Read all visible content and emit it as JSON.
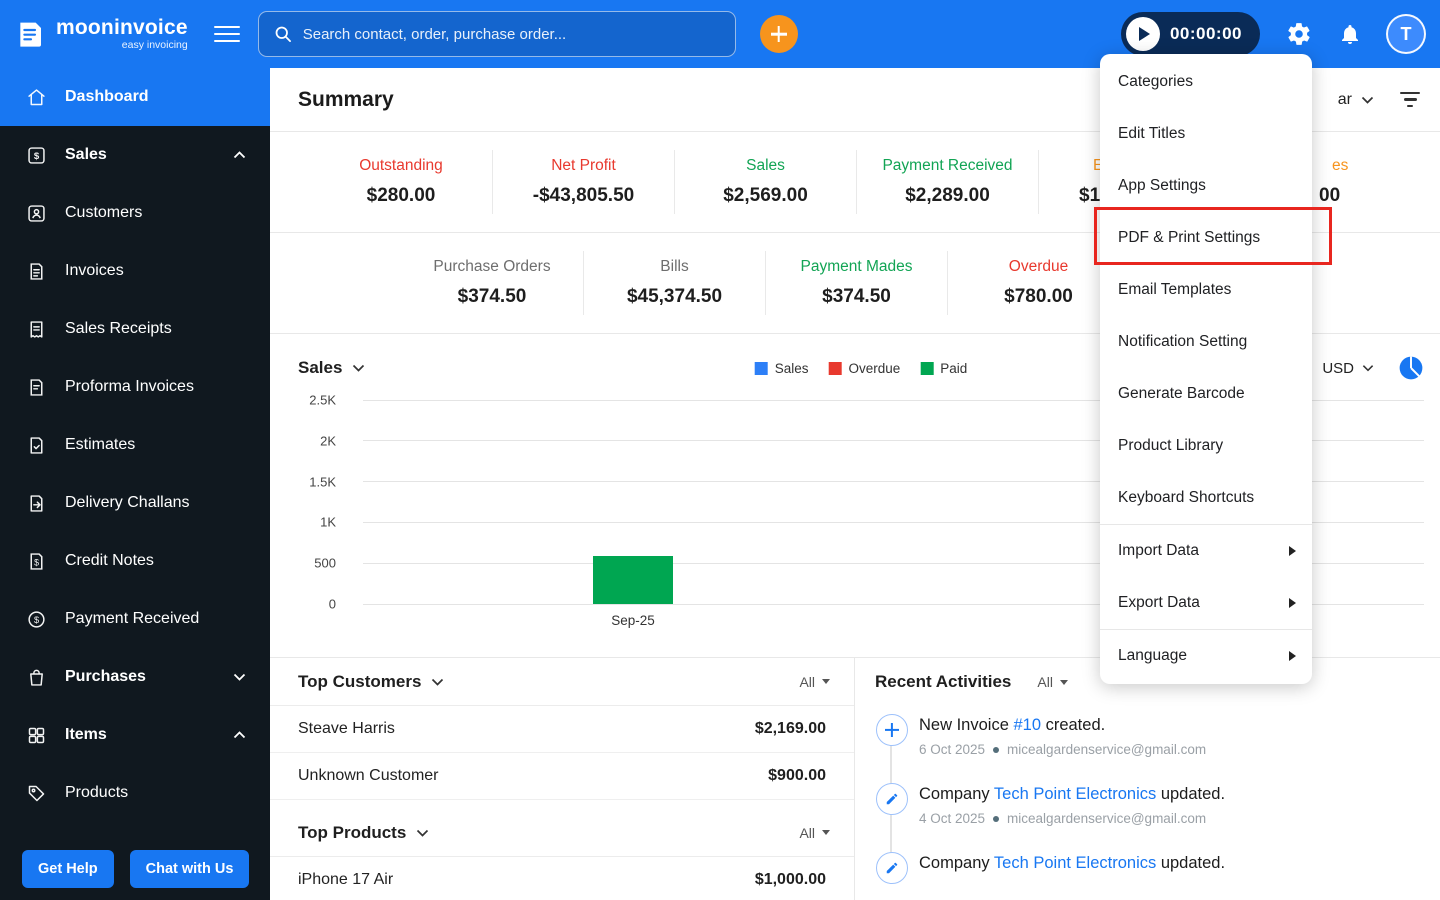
{
  "topbar": {
    "brand": "mooninvoice",
    "tagline": "easy invoicing",
    "search_placeholder": "Search contact, order, purchase order...",
    "timer": "00:00:00",
    "avatar_initial": "T"
  },
  "sidebar": {
    "items": [
      {
        "label": "Dashboard",
        "active": true
      },
      {
        "label": "Sales",
        "expanded": true
      },
      {
        "label": "Customers"
      },
      {
        "label": "Invoices"
      },
      {
        "label": "Sales Receipts"
      },
      {
        "label": "Proforma Invoices"
      },
      {
        "label": "Estimates"
      },
      {
        "label": "Delivery Challans"
      },
      {
        "label": "Credit Notes"
      },
      {
        "label": "Payment Received"
      },
      {
        "label": "Purchases",
        "expanded": false
      },
      {
        "label": "Items",
        "expanded": true
      },
      {
        "label": "Products"
      }
    ],
    "get_help_label": "Get Help",
    "chat_label": "Chat with Us"
  },
  "summary": {
    "title": "Summary",
    "period_fragment": "ar",
    "stats_row1": [
      {
        "label": "Outstanding",
        "value": "$280.00"
      },
      {
        "label": "Net Profit",
        "value": "-$43,805.50"
      },
      {
        "label": "Sales",
        "value": "$2,569.00"
      },
      {
        "label": "Payment Received",
        "value": "$2,289.00"
      },
      {
        "label": "E",
        "value": "$1"
      },
      {
        "label": "es",
        "value": "00"
      }
    ],
    "stats_row2": [
      {
        "label": "Purchase Orders",
        "value": "$374.50"
      },
      {
        "label": "Bills",
        "value": "$45,374.50"
      },
      {
        "label": "Payment Mades",
        "value": "$374.50"
      },
      {
        "label": "Overdue",
        "value": "$780.00"
      }
    ]
  },
  "chart_data": {
    "type": "bar",
    "title": "Sales",
    "currency": "USD",
    "categories": [
      "Sep-25"
    ],
    "series": [
      {
        "name": "Sales",
        "color": "#2D7FF7",
        "values": [
          0
        ]
      },
      {
        "name": "Overdue",
        "color": "#E8392E",
        "values": [
          0
        ]
      },
      {
        "name": "Paid",
        "color": "#00A651",
        "values": [
          585
        ]
      }
    ],
    "ylim": [
      0,
      2500
    ],
    "yticks": [
      {
        "label": "2.5K",
        "value": 2500
      },
      {
        "label": "2K",
        "value": 2000
      },
      {
        "label": "1.5K",
        "value": 1500
      },
      {
        "label": "1K",
        "value": 1000
      },
      {
        "label": "500",
        "value": 500
      },
      {
        "label": "0",
        "value": 0
      }
    ],
    "grid": true,
    "legend_position": "top-center"
  },
  "top_customers": {
    "title": "Top Customers",
    "filter": "All",
    "rows": [
      {
        "name": "Steave Harris",
        "amount": "$2,169.00"
      },
      {
        "name": "Unknown Customer",
        "amount": "$900.00"
      }
    ]
  },
  "top_products": {
    "title": "Top Products",
    "filter": "All",
    "rows": [
      {
        "name": "iPhone 17 Air",
        "amount": "$1,000.00"
      }
    ]
  },
  "recent_activities": {
    "title": "Recent Activities",
    "filter": "All",
    "entries": [
      {
        "text_prefix": "New Invoice ",
        "link": "#10",
        "text_suffix": " created.",
        "date": "6 Oct 2025",
        "email": "micealgardenservice@gmail.com"
      },
      {
        "text_prefix": "Company ",
        "link": "Tech Point Electronics",
        "text_suffix": " updated.",
        "date": "4 Oct 2025",
        "email": "micealgardenservice@gmail.com"
      },
      {
        "text_prefix": "Company ",
        "link": "Tech Point Electronics",
        "text_suffix": " updated.",
        "date": "",
        "email": ""
      }
    ]
  },
  "settings_menu": {
    "items": [
      {
        "label": "Categories"
      },
      {
        "label": "Edit Titles"
      },
      {
        "label": "App Settings"
      },
      {
        "label": "PDF & Print Settings",
        "highlighted": true
      },
      {
        "label": "Email Templates"
      },
      {
        "label": "Notification Setting"
      },
      {
        "label": "Generate Barcode"
      },
      {
        "label": "Product Library"
      },
      {
        "label": "Keyboard Shortcuts"
      },
      {
        "label": "Import Data",
        "submenu": true
      },
      {
        "label": "Export Data",
        "submenu": true
      },
      {
        "label": "Language",
        "submenu": true
      }
    ]
  },
  "colors": {
    "topbar_blue": "#1877F2",
    "sidebar_dark": "#10181F",
    "accent_orange": "#F7941D",
    "negative_red": "#E8392E",
    "positive_green": "#12A454",
    "link_blue": "#1877F2",
    "annotation_red": "#E8261F"
  }
}
